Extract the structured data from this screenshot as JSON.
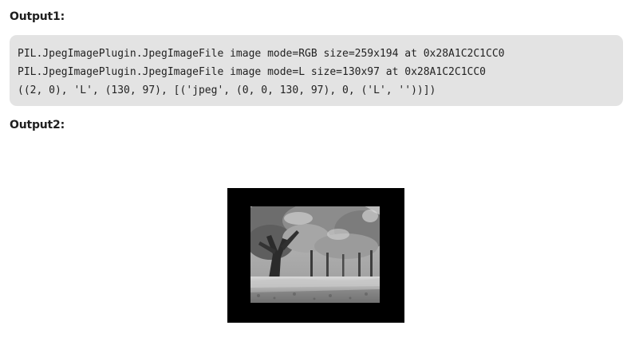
{
  "output1": {
    "heading": "Output1:",
    "lines": [
      "PIL.JpegImagePlugin.JpegImageFile image mode=RGB size=259x194 at 0x28A1C2C1CC0",
      "PIL.JpegImagePlugin.JpegImageFile image mode=L size=130x97 at 0x28A1C2C1CC0",
      "((2, 0), 'L', (130, 97), [('jpeg', (0, 0, 130, 97), 0, ('L', ''))])"
    ]
  },
  "output2": {
    "heading": "Output2:"
  }
}
